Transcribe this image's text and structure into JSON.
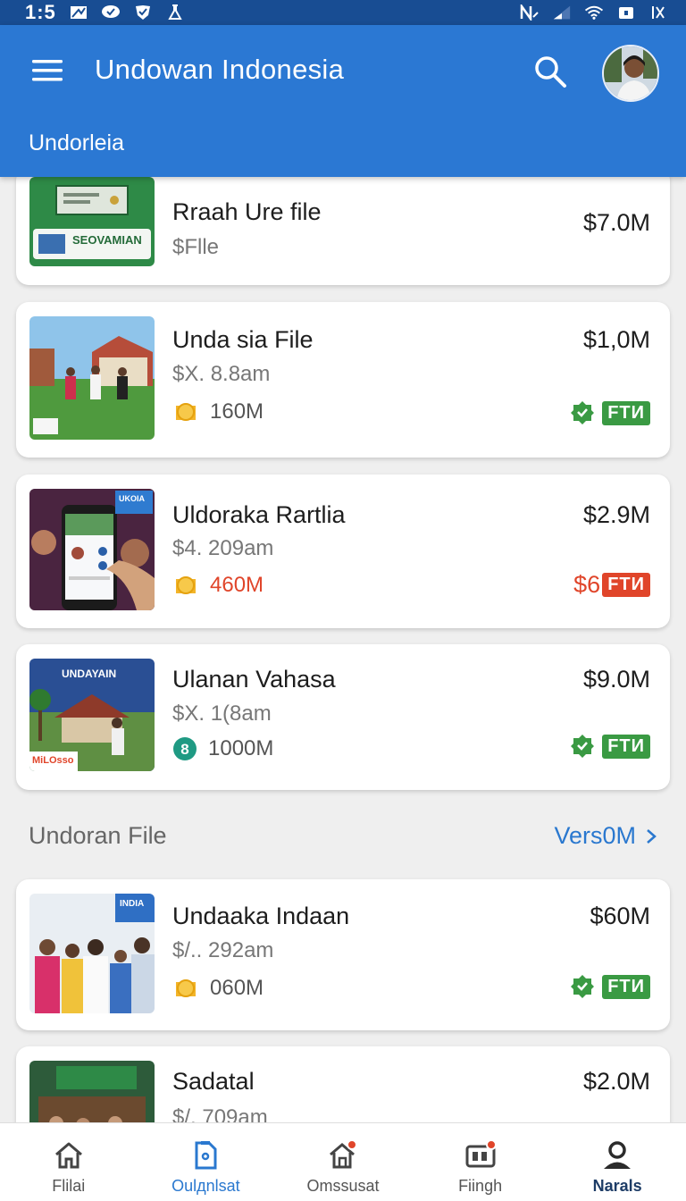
{
  "status_bar": {
    "time": "1:5"
  },
  "app_bar": {
    "title": "Undowan Indonesia",
    "subtitle": "Undorleia"
  },
  "cards": [
    {
      "title": "Rraah Ure file",
      "sub": "$Flle",
      "price": "$7.0M",
      "thumb_text": "SEOVAMIAN"
    },
    {
      "title": "Unda sia File",
      "sub": "$X. 8.8am",
      "meta": "160M",
      "price": "$1,0M",
      "badge": "FTИ"
    },
    {
      "title": "Uldoraka Rartlia",
      "sub": "$4. 209am",
      "meta": "460M",
      "price": "$2.9M",
      "badge_prefix": "$6",
      "badge": "FTИ",
      "thumb_text": "UKOIA"
    },
    {
      "title": "Ulanan Vahasa",
      "sub": "$X. 1(8am",
      "meta": "1000M",
      "price": "$9.0M",
      "badge": "FTИ",
      "thumb_text": "UNDAYAIN",
      "thumb_tag": "MiLOsso"
    },
    {
      "title": "Undaaka Indaan",
      "sub": "$/.. 292am",
      "meta": "060M",
      "price": "$60M",
      "badge": "FTИ",
      "thumb_text": "INDIA"
    },
    {
      "title": "Sadatal",
      "sub": "$/. 709am",
      "price": "$2.0M"
    }
  ],
  "section": {
    "title": "Undoran File",
    "link": "Vers0M"
  },
  "bottom_nav": [
    {
      "label": "Flilai"
    },
    {
      "label": "Oulдnlsat"
    },
    {
      "label": "Omssusat"
    },
    {
      "label": "Fiingh"
    },
    {
      "label": "Narals"
    }
  ],
  "colors": {
    "primary": "#2b78d3",
    "status_bar": "#184d93",
    "accent_green": "#3a9a43",
    "accent_red": "#e0452a",
    "link_blue": "#2a78cf"
  }
}
